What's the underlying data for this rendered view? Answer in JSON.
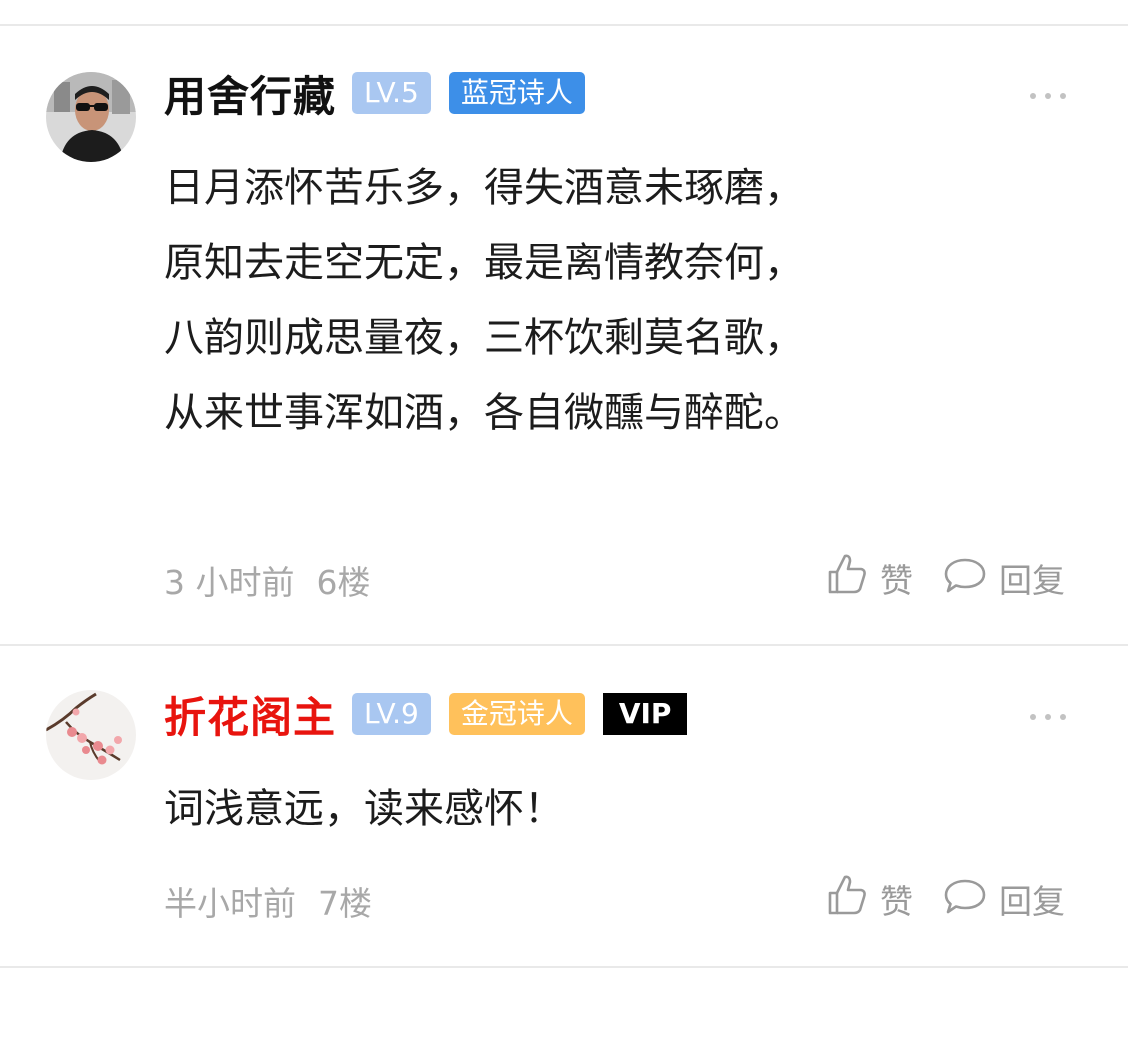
{
  "comments": [
    {
      "username": "用舍行藏",
      "username_color": "#111111",
      "level": "LV.5",
      "title_badge": "蓝冠诗人",
      "title_badge_color": "#3d8fe8",
      "content_lines": [
        "日月添怀苦乐多，得失酒意未琢磨，",
        "原知去走空无定，最是离情教奈何，",
        "八韵则成思量夜，三杯饮剩莫名歌，",
        "从来世事浑如酒，各自微醺与醉酡。"
      ],
      "time": "3 小时前",
      "floor": "6楼",
      "like_label": "赞",
      "reply_label": "回复"
    },
    {
      "username": "折花阁主",
      "username_color": "#e8140e",
      "level": "LV.9",
      "title_badge": "金冠诗人",
      "title_badge_color": "#ffc15b",
      "vip_badge": "VIP",
      "content_lines": [
        "词浅意远，读来感怀！"
      ],
      "time": "半小时前",
      "floor": "7楼",
      "like_label": "赞",
      "reply_label": "回复"
    }
  ],
  "icons": {
    "like": "thumbs-up-icon",
    "reply": "speech-bubble-icon",
    "more": "more-dots-icon"
  }
}
